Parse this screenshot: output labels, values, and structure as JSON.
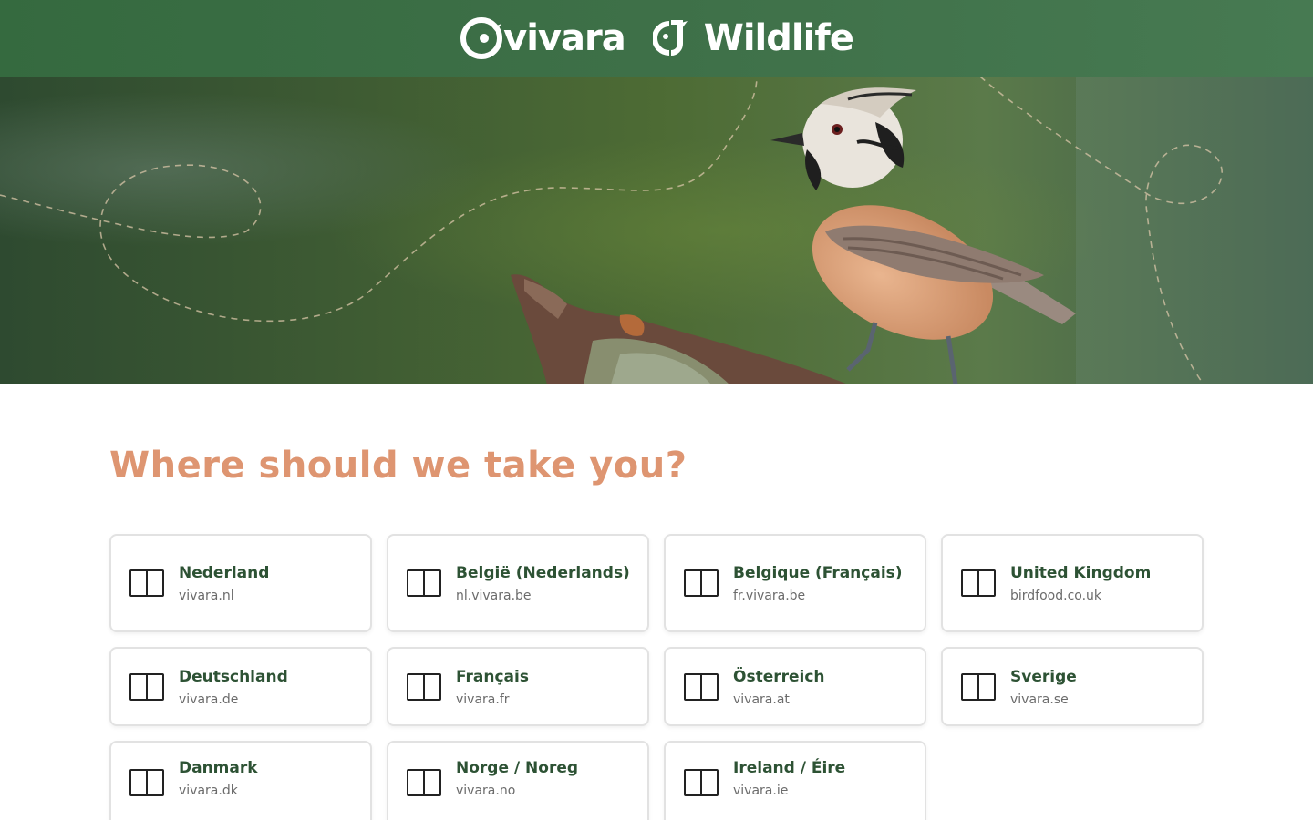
{
  "header": {
    "brand_primary": "vivara",
    "brand_secondary": "Wildlife"
  },
  "hero": {
    "image": "crested-tit-on-branch"
  },
  "main": {
    "heading": "Where should we take you?",
    "countries": [
      {
        "name": "Nederland",
        "url": "vivara.nl",
        "flag": "nl-flag-icon"
      },
      {
        "name": "België (Nederlands)",
        "url": "nl.vivara.be",
        "flag": "be-flag-icon"
      },
      {
        "name": "Belgique (Français)",
        "url": "fr.vivara.be",
        "flag": "be-flag-icon"
      },
      {
        "name": "United Kingdom",
        "url": "birdfood.co.uk",
        "flag": "gb-flag-icon"
      },
      {
        "name": "Deutschland",
        "url": "vivara.de",
        "flag": "de-flag-icon"
      },
      {
        "name": "Français",
        "url": "vivara.fr",
        "flag": "fr-flag-icon"
      },
      {
        "name": "Österreich",
        "url": "vivara.at",
        "flag": "at-flag-icon"
      },
      {
        "name": "Sverige",
        "url": "vivara.se",
        "flag": "se-flag-icon"
      },
      {
        "name": "Danmark",
        "url": "vivara.dk",
        "flag": "dk-flag-icon"
      },
      {
        "name": "Norge / Noreg",
        "url": "vivara.no",
        "flag": "no-flag-icon"
      },
      {
        "name": "Ireland / Éire",
        "url": "vivara.ie",
        "flag": "ie-flag-icon"
      }
    ]
  },
  "colors": {
    "header_bg": "#3e7048",
    "heading": "#de9571",
    "country_name": "#2d5234",
    "country_url": "#6b6b6b"
  }
}
